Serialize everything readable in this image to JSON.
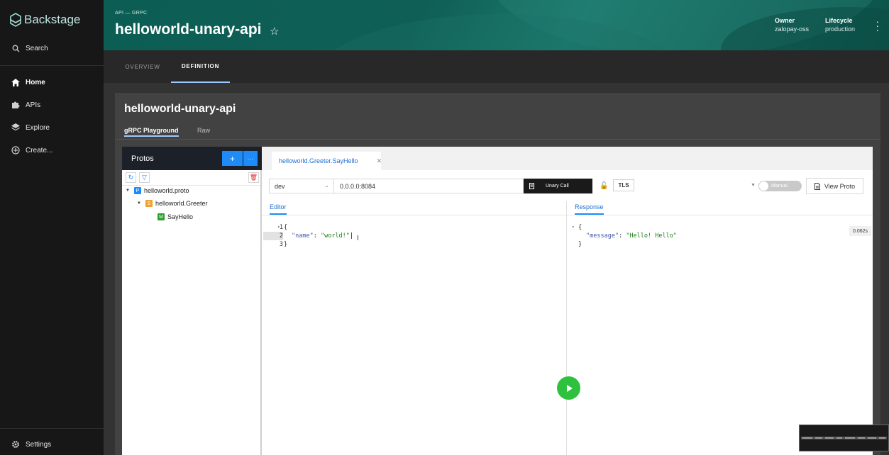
{
  "sidebar": {
    "brand": "Backstage",
    "search": "Search",
    "items": [
      {
        "label": "Home",
        "icon": "home-icon"
      },
      {
        "label": "APIs",
        "icon": "puzzle-icon"
      },
      {
        "label": "Explore",
        "icon": "layers-icon"
      },
      {
        "label": "Create...",
        "icon": "add-circle-icon"
      }
    ],
    "settings": "Settings"
  },
  "header": {
    "breadcrumb": "API — GRPC",
    "title": "helloworld-unary-api",
    "owner_label": "Owner",
    "owner_value": "zalopay-oss",
    "lifecycle_label": "Lifecycle",
    "lifecycle_value": "production"
  },
  "tabs": [
    "OVERVIEW",
    "DEFINITION"
  ],
  "content": {
    "title": "helloworld-unary-api",
    "subtabs": [
      "gRPC Playground",
      "Raw"
    ]
  },
  "protos": {
    "title": "Protos",
    "tree": [
      {
        "badge": "P",
        "label": "helloworld.proto",
        "color": "#1d8cf8"
      },
      {
        "badge": "S",
        "label": "helloworld.Greeter",
        "color": "#f0a030"
      },
      {
        "badge": "M",
        "label": "SayHello",
        "color": "#2ca02c"
      }
    ]
  },
  "request": {
    "tab_label": "helloworld.Greeter.SayHello",
    "env": "dev",
    "address": "0.0.0.0:8084",
    "call_label": "Unary Call",
    "tls_label": "TLS",
    "manual_label": "Manual",
    "view_proto_label": "View Proto",
    "editor_label": "Editor",
    "response_label": "Response",
    "timing": "0.062s"
  },
  "editor_lines": [
    {
      "n": "1",
      "text": "{"
    },
    {
      "n": "2",
      "key": "\"name\"",
      "sep": ": ",
      "val": "\"world!\""
    },
    {
      "n": "3",
      "text": "}"
    }
  ],
  "response_lines": [
    {
      "text": "{"
    },
    {
      "key": "\"message\"",
      "sep": ": ",
      "val": "\"Hello! Hello\""
    },
    {
      "text": "}"
    }
  ],
  "colors": {
    "accent": "#1d8cf8",
    "header": "#0f5f56",
    "play": "#2ec13d"
  }
}
